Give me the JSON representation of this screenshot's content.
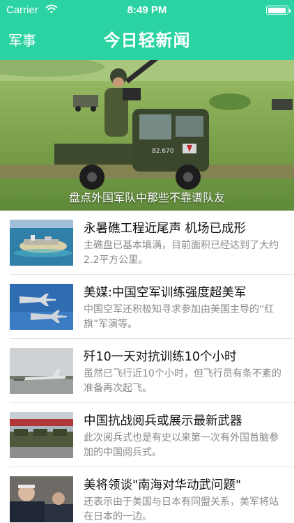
{
  "status_bar": {
    "carrier": "Carrier",
    "time": "8:49 PM"
  },
  "nav": {
    "left_label": "军事",
    "title": "今日轻新闻"
  },
  "hero": {
    "caption": "盘点外国军队中那些不靠谱队友",
    "image": "military-vehicle-photo"
  },
  "news": [
    {
      "title": "永暑礁工程近尾声 机场已成形",
      "summary": "主礁盘已基本填满，目前面积已经达到了大约2.2平方公里。",
      "thumb": "reef-island-photo"
    },
    {
      "title": "美媒:中国空军训练强度超美军",
      "summary": "中国空军还积极知寻求参加由美国主导的“红旗”军演等。",
      "thumb": "fighter-jets-photo"
    },
    {
      "title": "歼10一天对抗训练10个小时",
      "summary": "虽然已飞行近10个小时，但飞行员有条不紊的准备再次起飞。",
      "thumb": "airfield-jet-photo"
    },
    {
      "title": "中国抗战阅兵或展示最新武器",
      "summary": "此次阅兵式也是有史以来第一次有外国首脑参加的中国阅兵式。",
      "thumb": "parade-photo"
    },
    {
      "title": "美将领谈\"南海对华动武问题\"",
      "summary": "还表示由于美国与日本有同盟关系，美军将站在日本的一边。",
      "thumb": "admirals-photo"
    }
  ],
  "colors": {
    "header": "#2bd3a3",
    "title_text": "#111111",
    "summary_text": "#8a8a8a"
  }
}
